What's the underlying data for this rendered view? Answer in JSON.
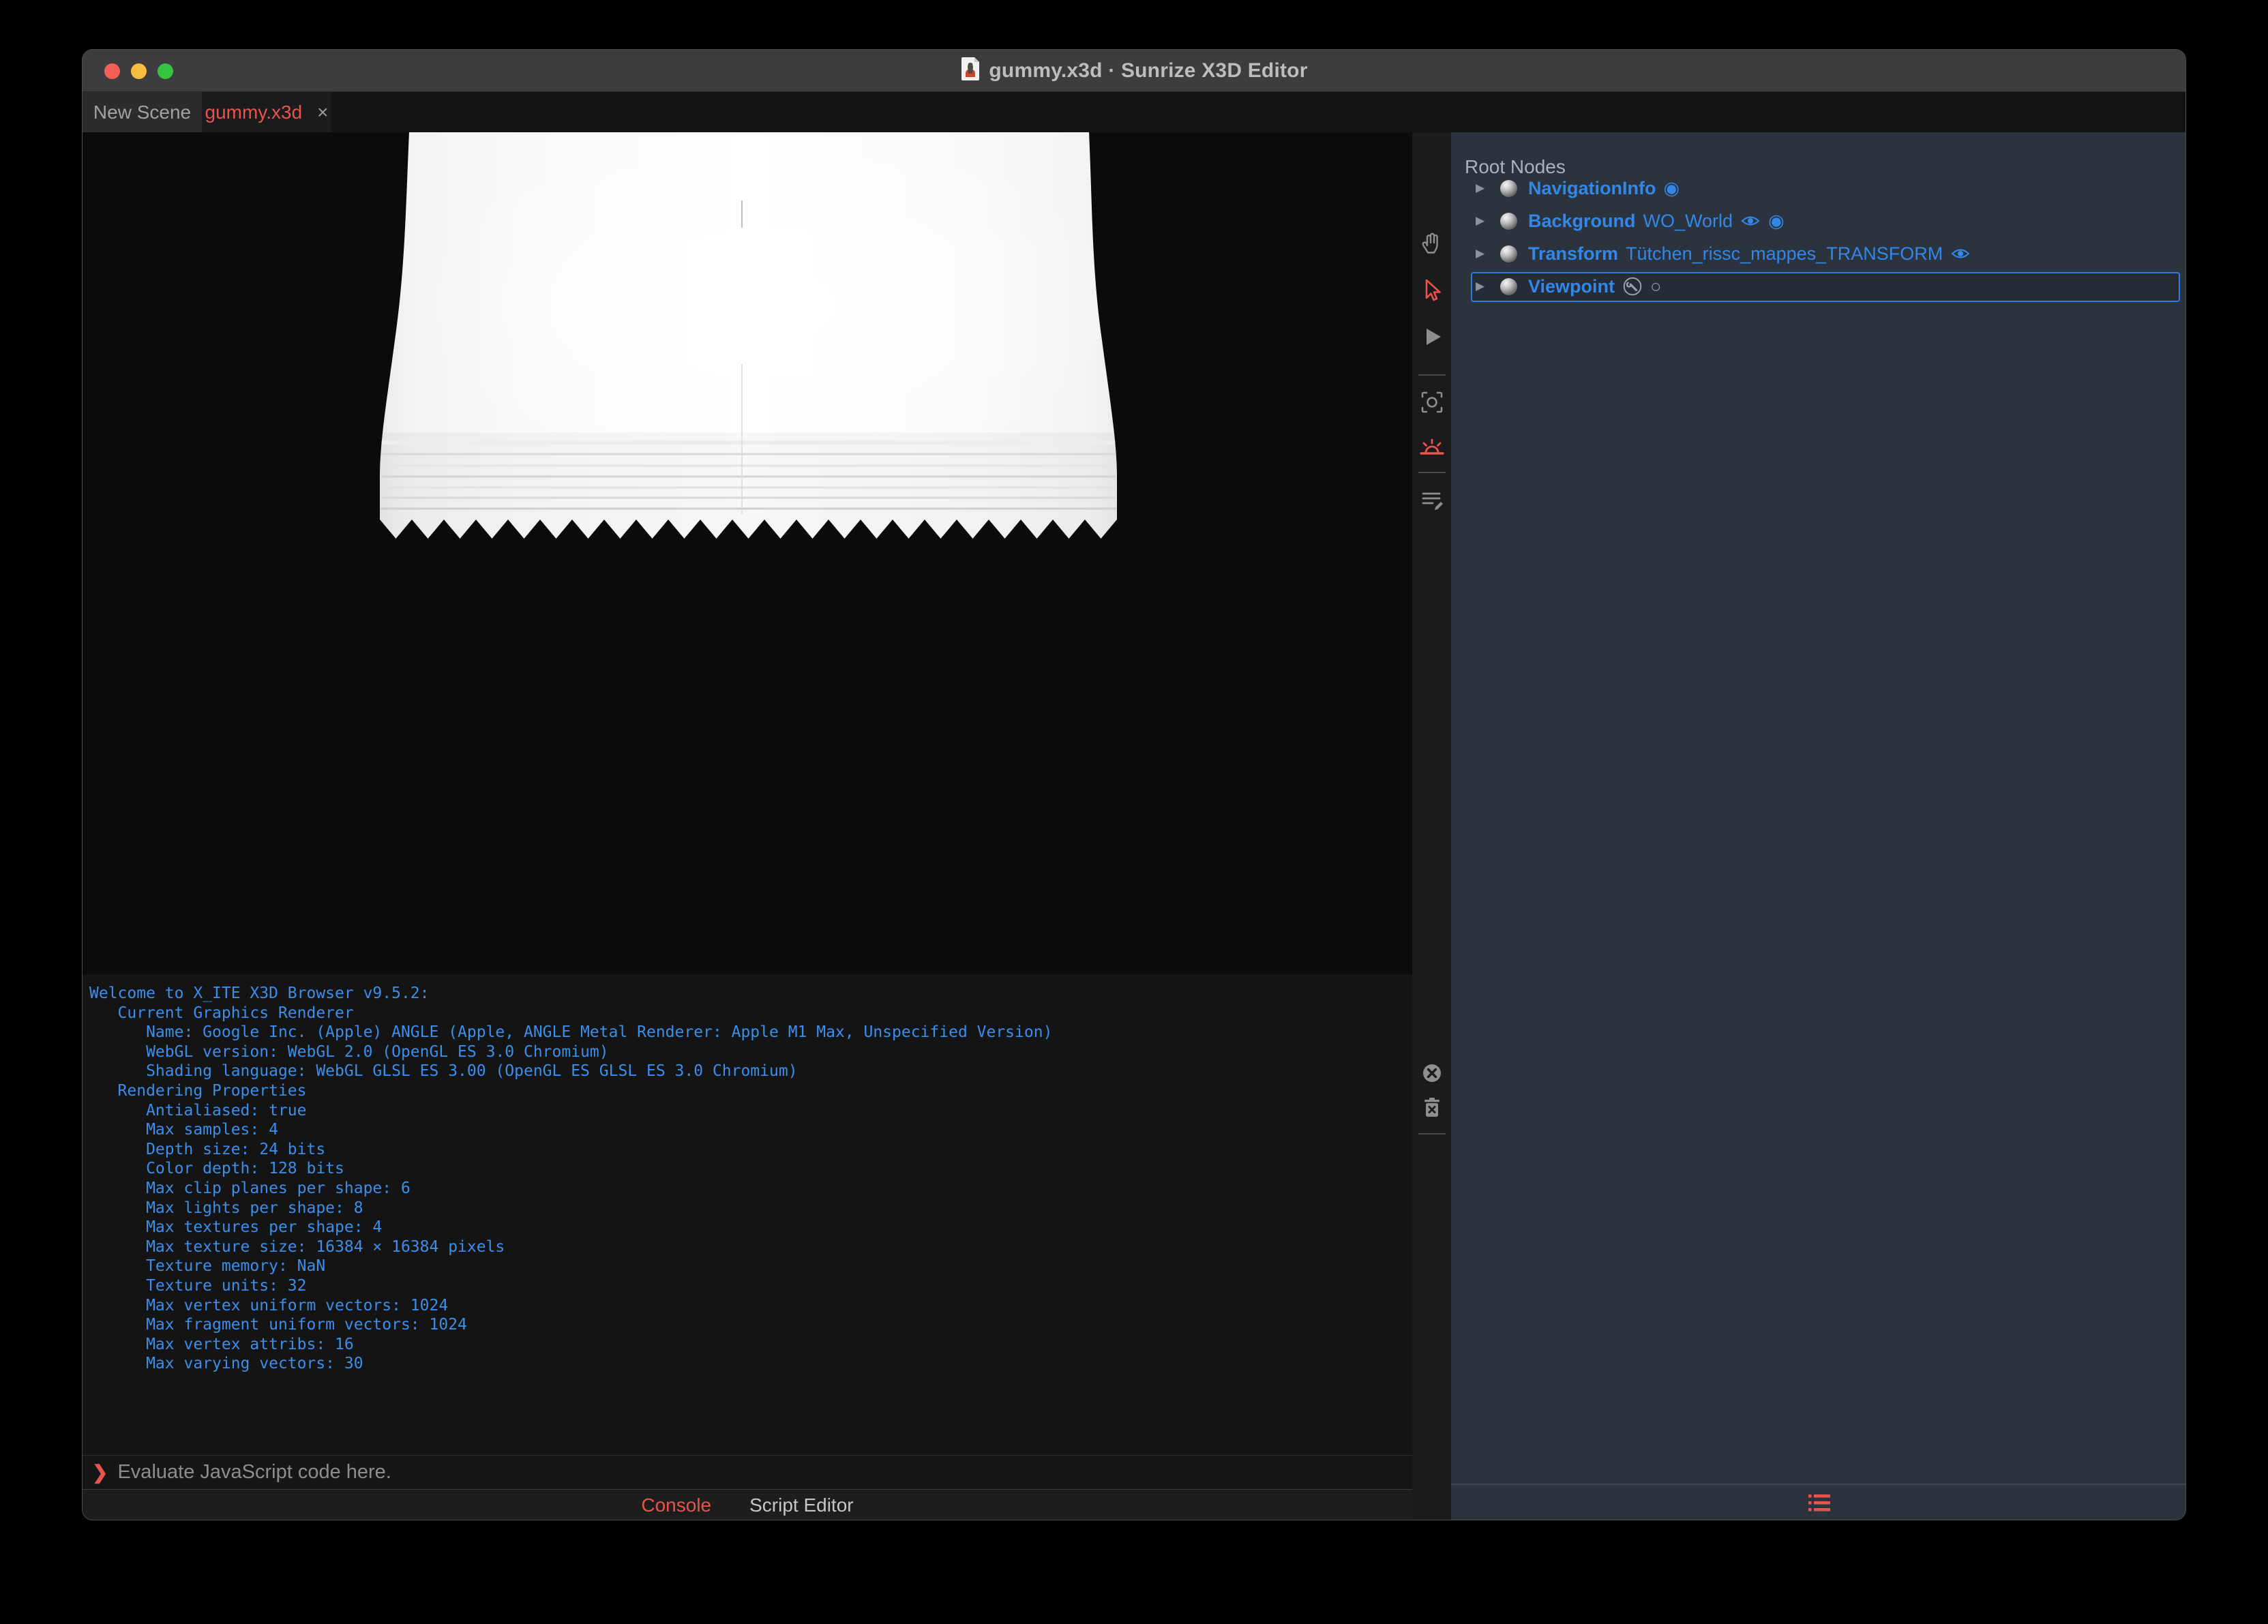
{
  "window": {
    "title": "gummy.x3d · Sunrize X3D Editor"
  },
  "tabs": {
    "new_scene": {
      "label": "New Scene"
    },
    "gummy": {
      "label": "gummy.x3d",
      "close_glyph": "×"
    }
  },
  "toolbar": {
    "tools": [
      "pan-hand",
      "select-arrow",
      "play",
      "snapshot",
      "sunrise-light",
      "script-edit"
    ],
    "console_tools": [
      "close-circle",
      "clear-trash"
    ]
  },
  "console": {
    "lines": [
      "Welcome to X_ITE X3D Browser v9.5.2:",
      "   Current Graphics Renderer",
      "      Name: Google Inc. (Apple) ANGLE (Apple, ANGLE Metal Renderer: Apple M1 Max, Unspecified Version)",
      "      WebGL version: WebGL 2.0 (OpenGL ES 3.0 Chromium)",
      "      Shading language: WebGL GLSL ES 3.00 (OpenGL ES GLSL ES 3.0 Chromium)",
      "   Rendering Properties",
      "      Antialiased: true",
      "      Max samples: 4",
      "      Depth size: 24 bits",
      "      Color depth: 128 bits",
      "      Max clip planes per shape: 6",
      "      Max lights per shape: 8",
      "      Max textures per shape: 4",
      "      Max texture size: 16384 × 16384 pixels",
      "      Texture memory: NaN",
      "      Texture units: 32",
      "      Max vertex uniform vectors: 1024",
      "      Max fragment uniform vectors: 1024",
      "      Max vertex attribs: 16",
      "      Max varying vectors: 30"
    ],
    "prompt": {
      "chevron": "❯",
      "placeholder": "Evaluate JavaScript code here."
    },
    "footer_tabs": {
      "console": "Console",
      "script_editor": "Script Editor"
    }
  },
  "outline": {
    "header": "Root Nodes",
    "expand_glyph": "▶",
    "bound_glyph": "◉",
    "unbound_glyph": "○",
    "nodes": [
      {
        "type": "NavigationInfo",
        "def": ""
      },
      {
        "type": "Background",
        "def": "WO_World"
      },
      {
        "type": "Transform",
        "def": "Tütchen_rissc_mappes_TRANSFORM"
      },
      {
        "type": "Viewpoint",
        "def": ""
      }
    ]
  },
  "colors": {
    "accent_red": "#e8544c",
    "console_blue": "#3b8eea",
    "tree_blue": "#3287e8",
    "selection_blue": "#2a7de1",
    "panel_bg": "#2b333f",
    "titlebar_bg": "#3d3d3f"
  }
}
